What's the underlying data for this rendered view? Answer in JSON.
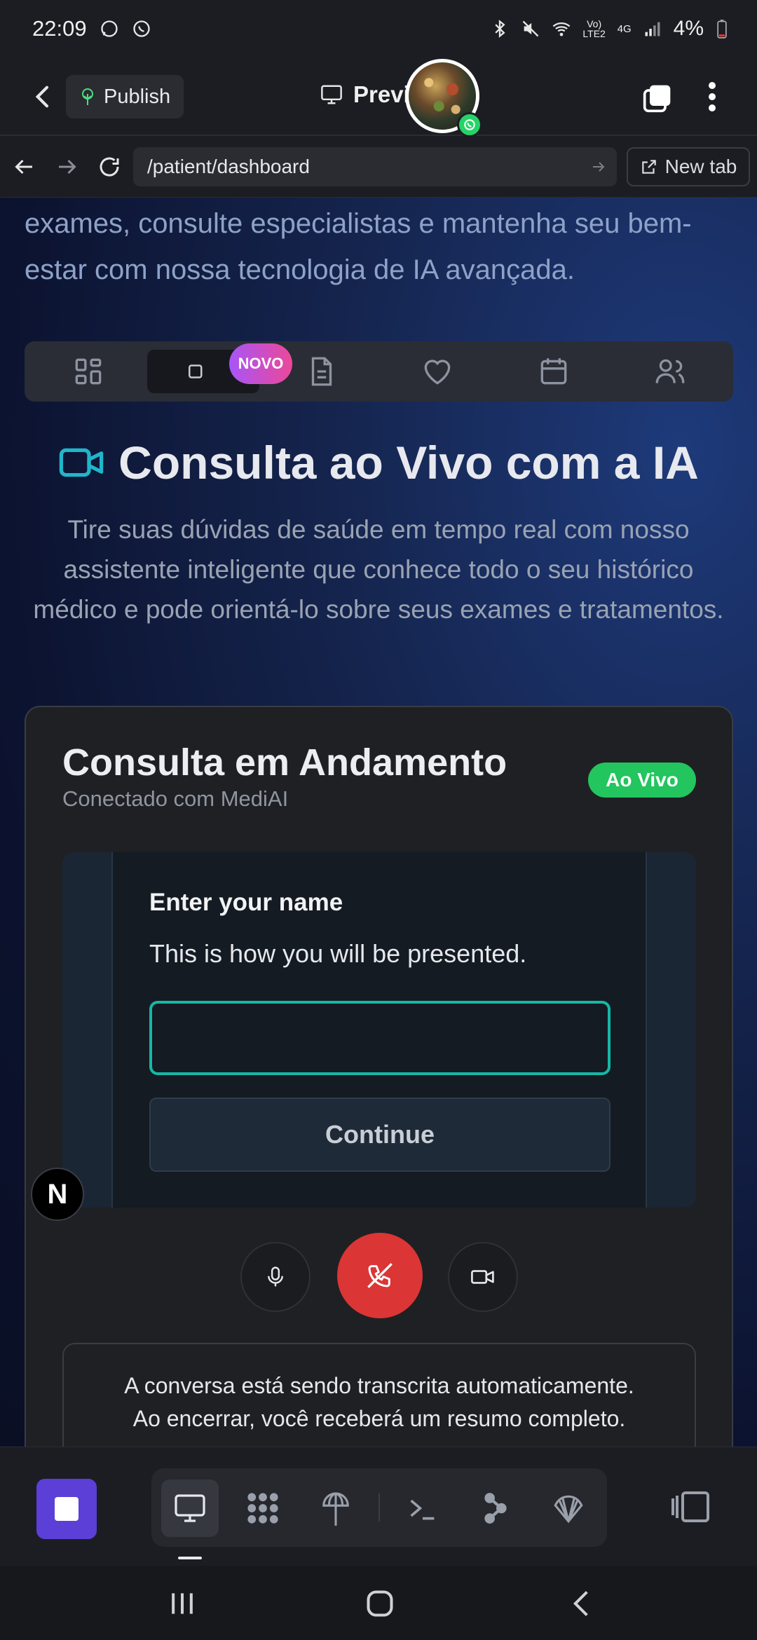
{
  "status_bar": {
    "time": "22:09",
    "network": "Vo) LTE2",
    "signal_type": "4G",
    "battery": "4%"
  },
  "app_bar": {
    "publish_label": "Publish",
    "preview_label": "Previ"
  },
  "url_bar": {
    "url": "/patient/dashboard",
    "new_tab_label": "New tab"
  },
  "page": {
    "intro_text": "exames, consulte especialistas e mantenha seu bem-estar com nossa tecnologia de IA avançada.",
    "tabs": [
      {
        "name": "dashboard"
      },
      {
        "name": "video-consulta"
      },
      {
        "name": "documentos"
      },
      {
        "name": "saude"
      },
      {
        "name": "agenda"
      },
      {
        "name": "especialistas"
      }
    ],
    "novo_badge": "NOVO",
    "hero_title": "Consulta ao Vivo com a IA",
    "hero_subtitle": "Tire suas dúvidas de saúde em tempo real com nosso assistente inteligente que conhece todo o seu histórico médico e pode orientá-lo sobre seus exames e tratamentos.",
    "card": {
      "title": "Consulta em Andamento",
      "subtitle": "Conectado com MediAI",
      "live_badge": "Ao Vivo",
      "name_prompt_title": "Enter your name",
      "name_prompt_hint": "This is how you will be presented.",
      "name_input_value": "",
      "continue_label": "Continue",
      "transcript_line1": "A conversa está sendo transcrita automaticamente.",
      "transcript_line2": "Ao encerrar, você receberá um resumo completo."
    },
    "fab_letter": "N"
  },
  "colors": {
    "accent_teal": "#14b8a6",
    "live_green": "#22c55e",
    "end_call_red": "#dc3535",
    "novo_gradient_start": "#a855f7",
    "novo_gradient_end": "#ec4899",
    "stop_purple": "#5b3fd6"
  },
  "toolbar": {
    "icons": [
      "monitor-icon",
      "apps-grid-icon",
      "deploy-tree-icon",
      "terminal-icon",
      "connections-icon",
      "shell-icon"
    ]
  }
}
